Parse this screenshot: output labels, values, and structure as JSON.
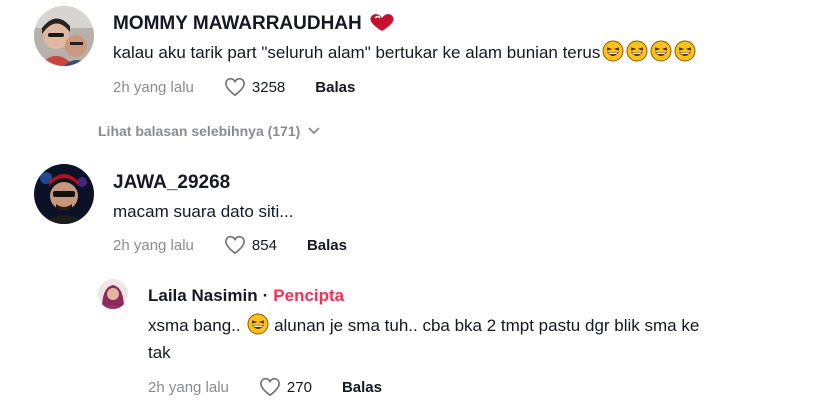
{
  "comments": [
    {
      "username": "MOMMY MAWARRAUDHAH",
      "text": "kalau aku tarik part \"seluruh alam\" bertukar ke alam bunian terus",
      "time": "2h yang lalu",
      "likes": "3258",
      "reply_label": "Balas",
      "view_replies": "Lihat balasan selebihnya (171)"
    },
    {
      "username": "JAWA_29268",
      "text": "macam suara dato siti...",
      "time": "2h yang lalu",
      "likes": "854",
      "reply_label": "Balas"
    }
  ],
  "reply": {
    "username": "Laila Nasimin",
    "separator": "·",
    "badge": "Pencipta",
    "text_part1": "xsma bang..",
    "text_part2": "alunan je sma tuh.. cba bka 2 tmpt pastu dgr blik sma ke",
    "text_line2": "tak",
    "time": "2h yang lalu",
    "likes": "270",
    "reply_label": "Balas"
  },
  "colors": {
    "accent": "#fe2c55",
    "muted": "#8a8b91",
    "text": "#161823"
  }
}
